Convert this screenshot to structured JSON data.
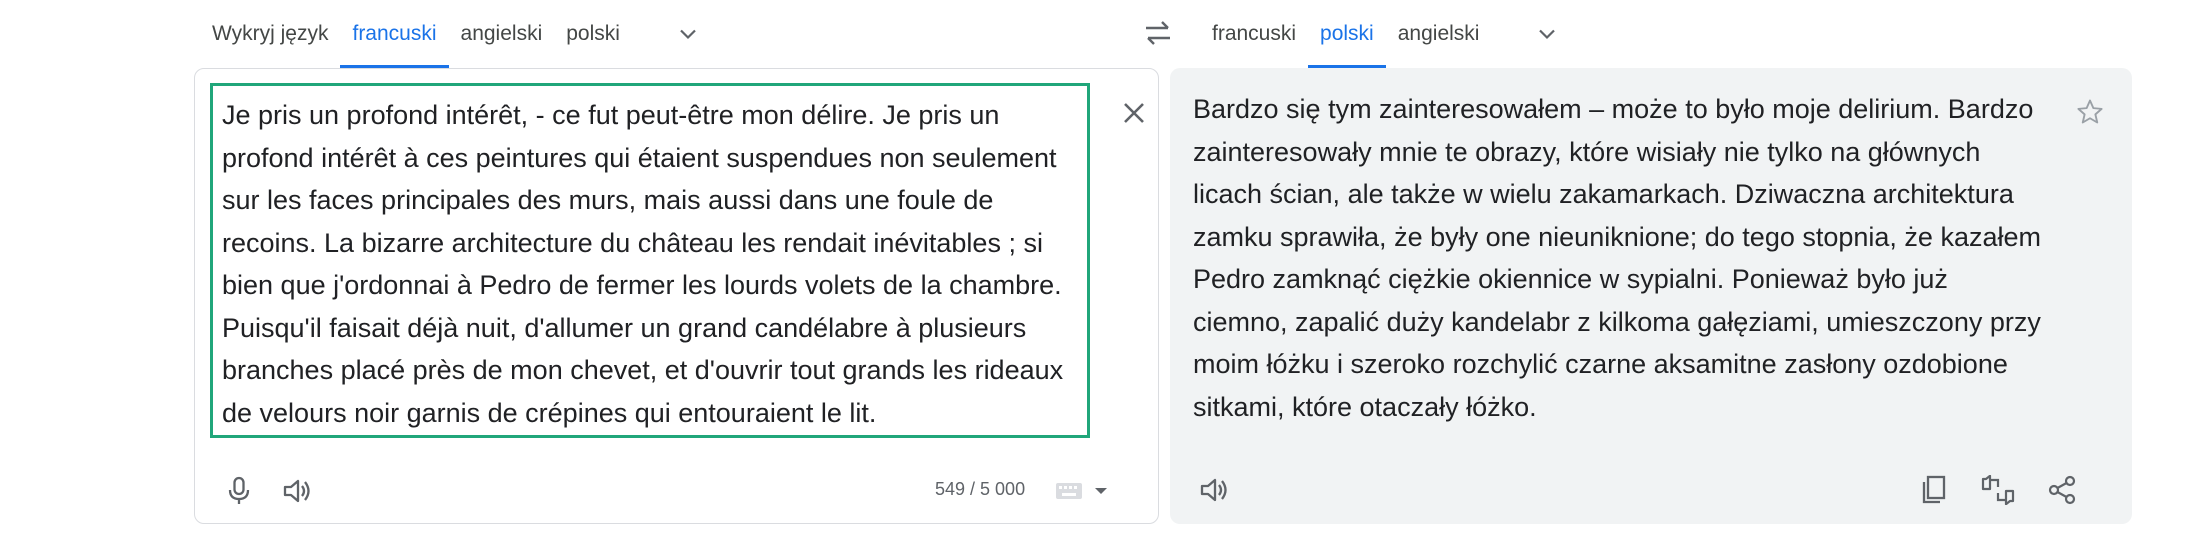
{
  "source_languages": {
    "tabs": [
      {
        "label": "Wykryj język",
        "active": false
      },
      {
        "label": "francuski",
        "active": true
      },
      {
        "label": "angielski",
        "active": false
      },
      {
        "label": "polski",
        "active": false
      }
    ]
  },
  "target_languages": {
    "tabs": [
      {
        "label": "francuski",
        "active": false
      },
      {
        "label": "polski",
        "active": true
      },
      {
        "label": "angielski",
        "active": false
      }
    ]
  },
  "source": {
    "text": "Je pris un profond intérêt, - ce fut peut-être mon délire. Je pris un\nprofond intérêt à ces peintures qui étaient suspendues non seulement\nsur les faces principales des murs, mais aussi dans une foule de\nrecoins. La bizarre architecture du château les rendait inévitables ; si\nbien que j'ordonnai à Pedro de fermer les lourds volets de la chambre.\nPuisqu'il faisait déjà nuit, d'allumer un grand candélabre à plusieurs\nbranches placé près de mon chevet, et d'ouvrir tout grands les rideaux\nde velours noir garnis de crépines qui entouraient le lit.",
    "char_count": "549 / 5 000"
  },
  "target": {
    "text": "Bardzo się tym zainteresowałem – może to było moje delirium. Bardzo\nzainteresowały mnie te obrazy, które wisiały nie tylko na głównych\nlicach ścian, ale także w wielu zakamarkach. Dziwaczna architektura\nzamku sprawiła, że były one nieuniknione; do tego stopnia, że kazałem\nPedro zamknąć ciężkie okiennice w sypialni. Ponieważ było już\nciemno, zapalić duży kandelabr z kilkoma gałęziami, umieszczony przy\nmoim łóżku i szeroko rozchylić czarne aksamitne zasłony ozdobione\nsitkami, które otaczały łóżko."
  },
  "colors": {
    "accent": "#1a73e8",
    "highlight_border": "#20a67a",
    "icon": "#5f6368",
    "text": "#202124"
  }
}
